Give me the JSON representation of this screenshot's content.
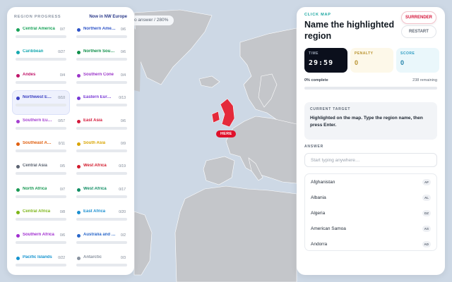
{
  "map": {
    "hint": "o answer / 280%",
    "marker": "HERE"
  },
  "left": {
    "title": "REGION PROGRESS",
    "now_in": "Now in NW Europe",
    "regions": [
      {
        "name": "Central America",
        "count": "0/7",
        "color": "#1aa35a"
      },
      {
        "name": "Northern Ame…",
        "count": "0/6",
        "color": "#2f55c8"
      },
      {
        "name": "Caribbean",
        "count": "0/27",
        "color": "#15a8b0"
      },
      {
        "name": "Northern Sou…",
        "count": "0/6",
        "color": "#0f8f4a"
      },
      {
        "name": "Andes",
        "count": "0/4",
        "color": "#c0166a"
      },
      {
        "name": "Southern Cone",
        "count": "0/4",
        "color": "#9b35c9"
      },
      {
        "name": "Northwest E…",
        "count": "0/10",
        "color": "#3a3fc2",
        "active": true
      },
      {
        "name": "Eastern Eur…",
        "count": "0/13",
        "color": "#7a3ad6"
      },
      {
        "name": "Southern Eu…",
        "count": "0/57",
        "color": "#a43fd0"
      },
      {
        "name": "East Asia",
        "count": "0/6",
        "color": "#d4183a"
      },
      {
        "name": "Southeast A…",
        "count": "0/11",
        "color": "#e06010"
      },
      {
        "name": "South Asia",
        "count": "0/9",
        "color": "#d9a400"
      },
      {
        "name": "Central Asia",
        "count": "0/5",
        "color": "#5a6270"
      },
      {
        "name": "West Africa",
        "count": "0/19",
        "color": "#d21a2c"
      },
      {
        "name": "North Africa",
        "count": "0/7",
        "color": "#1b9a55"
      },
      {
        "name": "West Africa",
        "count": "0/17",
        "color": "#148f66"
      },
      {
        "name": "Central Africa",
        "count": "0/8",
        "color": "#7cb518"
      },
      {
        "name": "East Africa",
        "count": "0/20",
        "color": "#1b8fd0"
      },
      {
        "name": "Southern Africa",
        "count": "0/6",
        "color": "#a12fd0"
      },
      {
        "name": "Australia and …",
        "count": "0/2",
        "color": "#2a67c9"
      },
      {
        "name": "Pacific Islands",
        "count": "0/22",
        "color": "#1493cf"
      },
      {
        "name": "Antarctic",
        "count": "0/3",
        "color": "#8a93a0"
      }
    ]
  },
  "right": {
    "mode": "CLICK MAP",
    "title": "Name the highlighted region",
    "surrender": "SURRENDER",
    "restart": "RESTART",
    "stats": {
      "time_label": "TIME",
      "time": "29:59",
      "penalty_label": "PENALTY",
      "penalty": "0",
      "score_label": "SCORE",
      "score": "0"
    },
    "progress": {
      "complete": "0% complete",
      "remaining": "238 remaining",
      "fraction": 0.0
    },
    "target": {
      "label": "CURRENT TARGET",
      "text": "Highlighted on the map. Type the region name, then press Enter."
    },
    "answer": {
      "label": "ANSWER",
      "placeholder": "Start typing anywhere…",
      "value": ""
    },
    "suggestions": [
      {
        "name": "Afghanistan",
        "code": "AF"
      },
      {
        "name": "Albania",
        "code": "AL"
      },
      {
        "name": "Algeria",
        "code": "DZ"
      },
      {
        "name": "American Samoa",
        "code": "AS"
      },
      {
        "name": "Andorra",
        "code": "AD"
      }
    ]
  }
}
